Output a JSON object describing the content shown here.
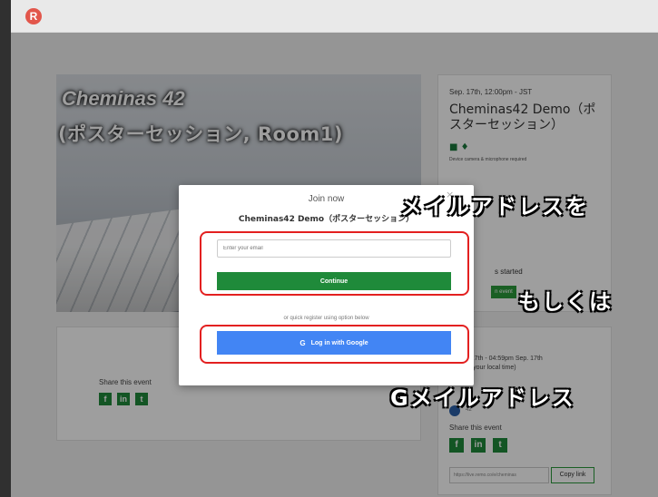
{
  "app": {
    "logo_letter": "R",
    "brand_color": "#e2564b",
    "accent": "#1f8a3a",
    "google_blue": "#4285f4"
  },
  "hero": {
    "title": "Cheminas 42",
    "subtitle": "(ポスターセッション, Room1)"
  },
  "event_card": {
    "date": "Sep. 17th, 12:00pm - JST",
    "name": "Cheminas42 Demo（ポスターセッション）",
    "device_note": "Device camera & microphone required",
    "started_text": "s started",
    "join_label": "n event"
  },
  "share_card": {
    "label": "Share this event",
    "icons": [
      "facebook-icon",
      "linkedin-icon",
      "twitter-icon"
    ]
  },
  "time_card": {
    "time_line1": "p. 17th - 04:59pm Sep. 17th",
    "time_line2": "(In your local time)",
    "host_name": "42",
    "share_label": "Share this event",
    "link_value": "https://live.remo.co/e/cheminas",
    "copy_label": "Copy link"
  },
  "modal": {
    "close_glyph": "×",
    "title": "Join now",
    "event_name": "Cheminas42 Demo（ポスターセッション）",
    "email_placeholder": "Enter your email",
    "continue_label": "Continue",
    "or_text": "or quick register using option below",
    "google_label": "Log in with Google",
    "google_glyph": "G"
  },
  "annotations": {
    "line1": "メイルアドレスを",
    "line2": "もしくは",
    "line3": "Gメイルアドレス"
  },
  "highlight_color": "#e32020"
}
